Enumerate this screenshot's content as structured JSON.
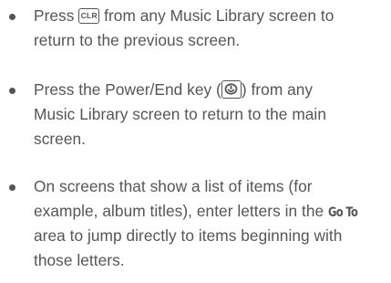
{
  "items": [
    {
      "lines": [
        {
          "before": "Press ",
          "key_label": "CLR",
          "after": " from any Music Library screen to"
        },
        {
          "text": "return to the previous screen."
        }
      ]
    },
    {
      "lines": [
        {
          "before": "Press the Power/End key (",
          "after": ") from any"
        },
        {
          "text": "Music Library screen to return to the main"
        },
        {
          "text": "screen."
        }
      ]
    },
    {
      "lines": [
        {
          "text": "On screens that show a list of items (for"
        },
        {
          "before": "example, album titles), enter letters in the ",
          "goto": "Go To"
        },
        {
          "text": "area to jump directly to items beginning with"
        },
        {
          "text": "those letters."
        }
      ]
    }
  ],
  "icons": {
    "clr_key": "clr-key-icon",
    "power_key": "power-end-key-icon"
  }
}
